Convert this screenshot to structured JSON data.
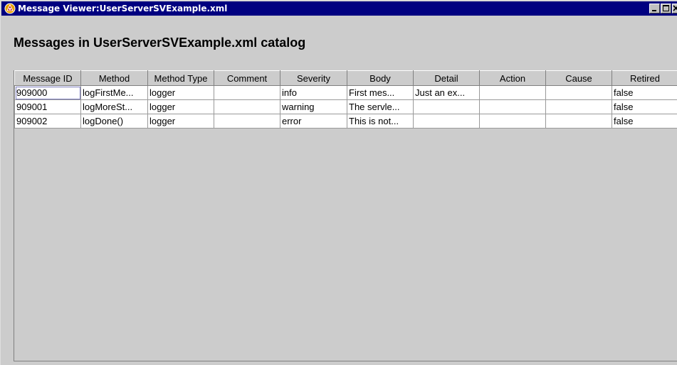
{
  "window": {
    "title": "Message Viewer:UserServerSVExample.xml",
    "controls": {
      "minimize": "minimize-icon",
      "maximize": "maximize-icon",
      "close": "close-icon"
    }
  },
  "heading": "Messages in UserServerSVExample.xml catalog",
  "table": {
    "columns": [
      "Message ID",
      "Method",
      "Method Type",
      "Comment",
      "Severity",
      "Body",
      "Detail",
      "Action",
      "Cause",
      "Retired"
    ],
    "rows": [
      [
        "909000",
        "logFirstMe...",
        "logger",
        "",
        "info",
        "First mes...",
        "Just an ex...",
        "",
        "",
        "false"
      ],
      [
        "909001",
        "logMoreSt...",
        "logger",
        "",
        "warning",
        "The servle...",
        "",
        "",
        "",
        "false"
      ],
      [
        "909002",
        "logDone()",
        "logger",
        "",
        "error",
        "This is not...",
        "",
        "",
        "",
        "false"
      ]
    ]
  },
  "colors": {
    "titlebar": "#000080",
    "window_bg": "#cccccc",
    "cell_bg": "#ffffff"
  }
}
